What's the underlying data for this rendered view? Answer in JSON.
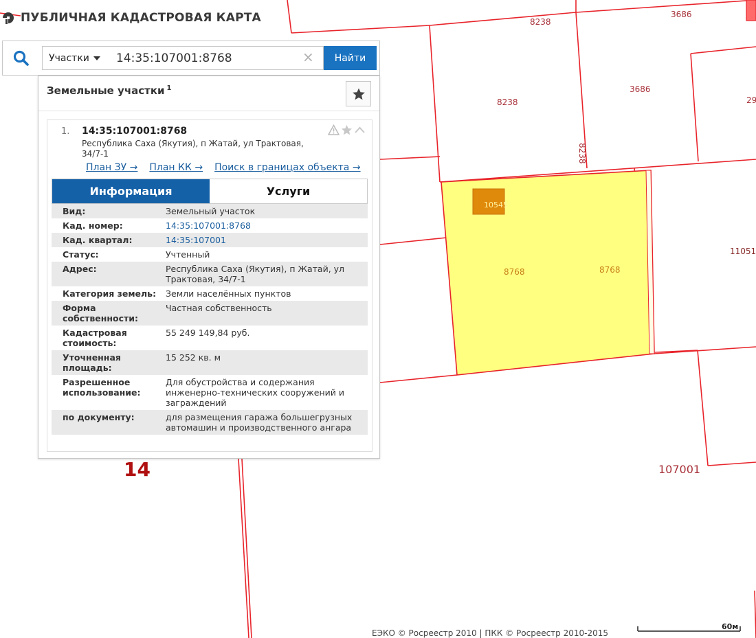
{
  "app": {
    "title": "ПУБЛИЧНАЯ КАДАСТРОВАЯ КАРТА"
  },
  "search": {
    "type_label": "Участки",
    "value": "14:35:107001:8768",
    "button": "Найти"
  },
  "panel": {
    "title": "Земельные участки",
    "count": "1"
  },
  "result": {
    "index": "1.",
    "cadnum": "14:35:107001:8768",
    "address": "Республика Саха (Якутия), п Жатай, ул Трактовая, 34/7-1",
    "links": [
      "План ЗУ →",
      "План КК →",
      "Поиск в границах объекта →"
    ],
    "tabs": {
      "info": "Информация",
      "services": "Услуги"
    },
    "attributes": [
      {
        "k": "Вид:",
        "v": "Земельный участок"
      },
      {
        "k": "Кад. номер:",
        "v": "14:35:107001:8768"
      },
      {
        "k": "Кад. квартал:",
        "v": "14:35:107001"
      },
      {
        "k": "Статус:",
        "v": "Учтенный"
      },
      {
        "k": "Адрес:",
        "v": "Республика Саха (Якутия), п Жатай, ул Трактовая, 34/7-1"
      },
      {
        "k": "Категория земель:",
        "v": "Земли населённых пунктов"
      },
      {
        "k": "Форма собственности:",
        "v": "Частная собственность"
      },
      {
        "k": "Кадастровая стоимость:",
        "v": "55 249 149,84 руб."
      },
      {
        "k": "Уточненная площадь:",
        "v": "15 252 кв. м"
      },
      {
        "k": "Разрешенное использование:",
        "v": "Для обустройства и содержания инженерно-технических сооружений и заграждений"
      },
      {
        "k": "по документу:",
        "v": "для размещения гаража большегрузных автомашин и производственного ангара"
      }
    ]
  },
  "map": {
    "labels": {
      "l8238_top": "8238",
      "l3686_top": "3686",
      "l8238_mid": "8238",
      "l3686_mid": "3686",
      "l29": "29",
      "l8238_vert": "8238",
      "l10545": "10545",
      "l8768_a": "8768",
      "l8768_b": "8768",
      "l11051": "11051",
      "l14": "14",
      "l107001": "107001"
    },
    "colors": {
      "boundary": "#e8242b",
      "selected_fill": "#ffff80",
      "building_fill": "#e08a0c",
      "accent": "#1a73c1"
    }
  },
  "footer": {
    "copyright": "ЕЭКО © Росреестр 2010 | ПКК © Росреестр 2010-2015",
    "scale": "60м"
  }
}
